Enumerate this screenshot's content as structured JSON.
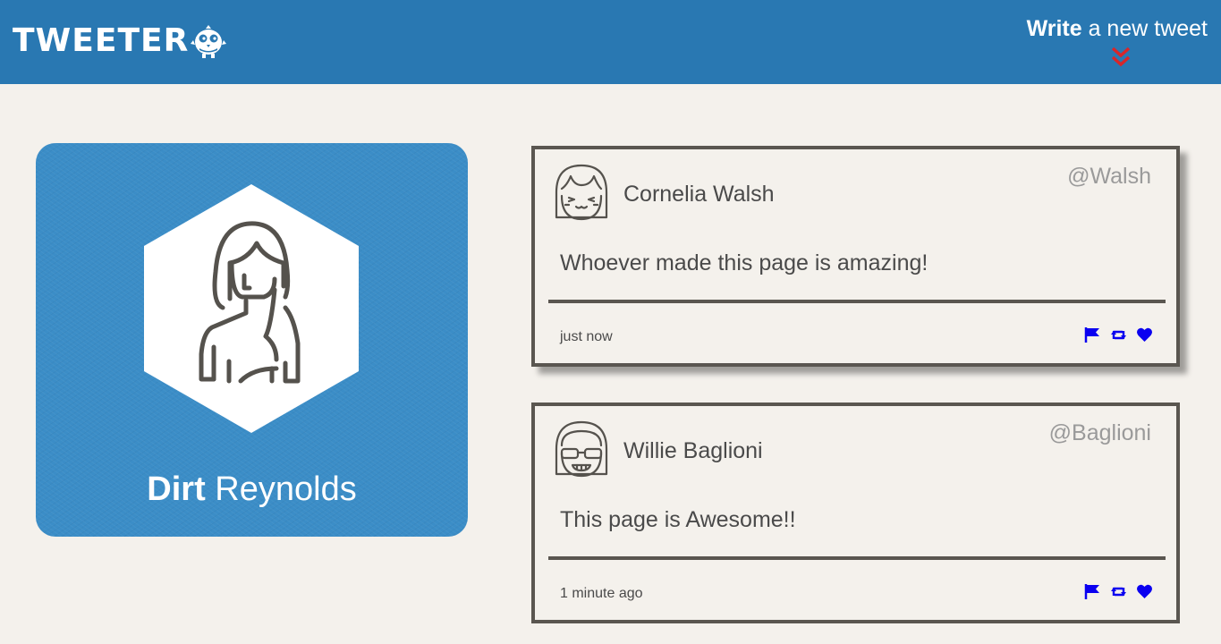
{
  "header": {
    "logo_text": "TWEETER",
    "logo_icon": "owl-icon",
    "compose_bold": "Write",
    "compose_rest": " a new tweet",
    "compose_icon": "double-chevron-down-icon",
    "bar_color": "#2978b2",
    "arrow_color": "#d8262a"
  },
  "profile": {
    "first_name": "Dirt",
    "last_name": " Reynolds",
    "card_color": "#3b8dc7",
    "avatar_icon": "woman-avatar-icon"
  },
  "tweets": [
    {
      "author": "Cornelia Walsh",
      "handle": "@Walsh",
      "content": "Whoever made this page is amazing!",
      "time": "just now",
      "avatar_icon": "smiling-girl-avatar-icon"
    },
    {
      "author": "Willie Baglioni",
      "handle": "@Baglioni",
      "content": "This page is Awesome!!",
      "time": "1 minute ago",
      "avatar_icon": "sunglasses-avatar-icon"
    }
  ],
  "actions": {
    "icons": [
      "flag-icon",
      "retweet-icon",
      "heart-icon"
    ],
    "color": "#0a00f0"
  }
}
